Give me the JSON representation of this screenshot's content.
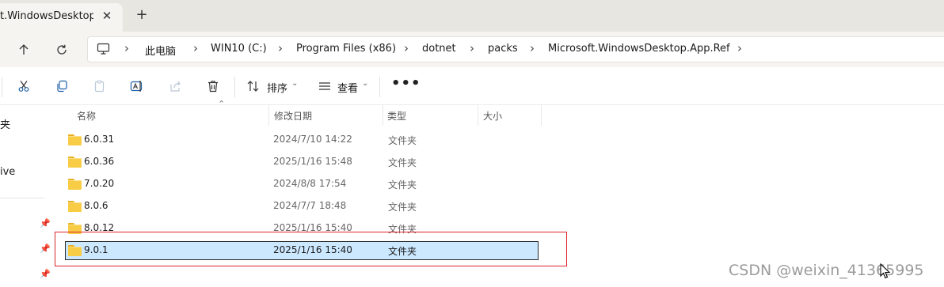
{
  "tab": {
    "title": "t.WindowsDesktop.Ap",
    "close": "✕",
    "new_tab": "+"
  },
  "breadcrumb": [
    "此电脑",
    "WIN10 (C:)",
    "Program Files (x86)",
    "dotnet",
    "packs",
    "Microsoft.WindowsDesktop.App.Ref"
  ],
  "toolbar": {
    "sort_label": "排序",
    "view_label": "查看",
    "more": "•••"
  },
  "sidebar": {
    "items": [
      "夹",
      "ive"
    ]
  },
  "columns": {
    "name": "名称",
    "date": "修改日期",
    "type": "类型",
    "size": "大小"
  },
  "files": [
    {
      "name": "6.0.31",
      "date": "2024/7/10 14:22",
      "type": "文件夹"
    },
    {
      "name": "6.0.36",
      "date": "2025/1/16 15:48",
      "type": "文件夹"
    },
    {
      "name": "7.0.20",
      "date": "2024/8/8 17:54",
      "type": "文件夹"
    },
    {
      "name": "8.0.6",
      "date": "2024/7/7 18:48",
      "type": "文件夹"
    },
    {
      "name": "8.0.12",
      "date": "2025/1/16 15:40",
      "type": "文件夹"
    },
    {
      "name": "9.0.1",
      "date": "2025/1/16 15:40",
      "type": "文件夹",
      "selected": true
    }
  ],
  "watermark": "CSDN @weixin_41365995",
  "colors": {
    "selection": "#cce8ff",
    "highlight_border": "#d9262c",
    "folder": "#f8cc44"
  }
}
